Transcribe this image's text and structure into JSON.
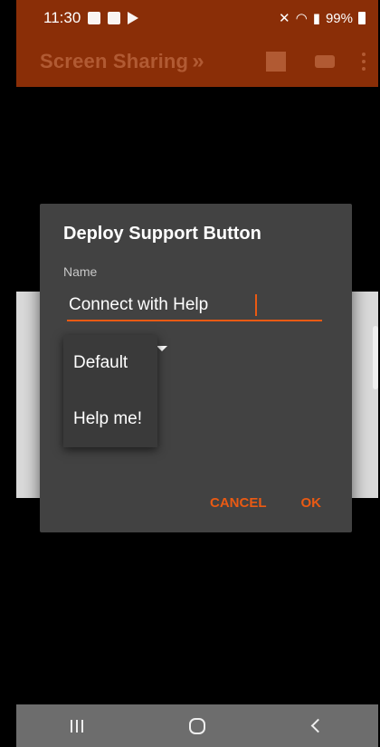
{
  "status_bar": {
    "time": "11:30",
    "battery": "99%",
    "icons": [
      "image-icon",
      "close-box-icon",
      "cast-icon"
    ],
    "right_icons": [
      "mute-icon",
      "wifi-icon",
      "signal-icon",
      "battery-icon"
    ]
  },
  "toolbar": {
    "title": "Screen Sharing",
    "chevron": "»",
    "actions": [
      "stop-icon",
      "keyboard-icon",
      "more-vertical-icon"
    ],
    "color": "#8a2e07"
  },
  "dialog": {
    "title": "Deploy Support Button",
    "field_label": "Name",
    "field_value": "Connect with Help",
    "dropdown_options": [
      "Default",
      "Help me!"
    ],
    "cancel_label": "CANCEL",
    "ok_label": "OK",
    "accent": "#ea5a13"
  },
  "nav_bar": {
    "buttons": [
      "recent-apps-icon",
      "home-icon",
      "back-icon"
    ]
  }
}
